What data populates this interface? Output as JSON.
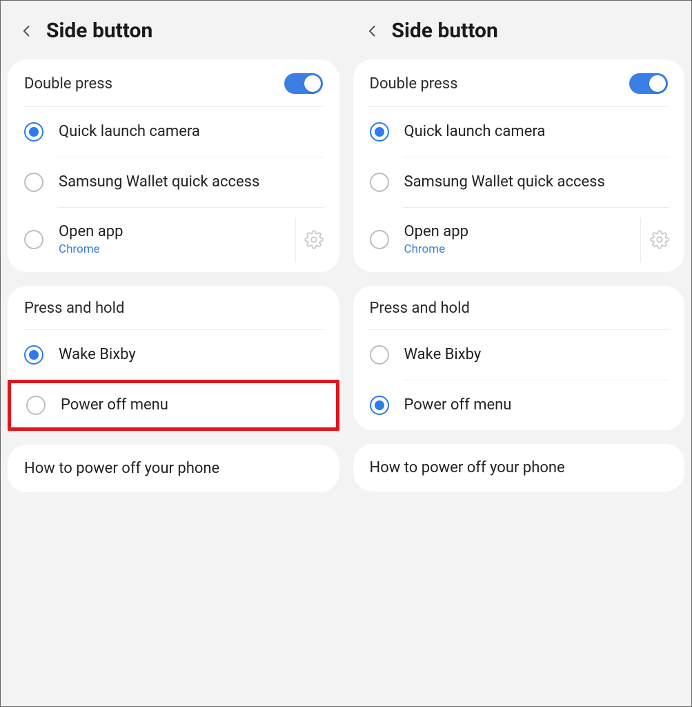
{
  "left": {
    "title": "Side button",
    "doublePress": {
      "header": "Double press",
      "toggleOn": true,
      "options": [
        {
          "label": "Quick launch camera",
          "sub": null,
          "selected": true,
          "gear": false
        },
        {
          "label": "Samsung Wallet quick access",
          "sub": null,
          "selected": false,
          "gear": false
        },
        {
          "label": "Open app",
          "sub": "Chrome",
          "selected": false,
          "gear": true
        }
      ]
    },
    "pressHold": {
      "header": "Press and hold",
      "options": [
        {
          "label": "Wake Bixby",
          "selected": true
        },
        {
          "label": "Power off menu",
          "selected": false,
          "highlighted": true
        }
      ]
    },
    "help": "How to power off your phone"
  },
  "right": {
    "title": "Side button",
    "doublePress": {
      "header": "Double press",
      "toggleOn": true,
      "options": [
        {
          "label": "Quick launch camera",
          "sub": null,
          "selected": true,
          "gear": false
        },
        {
          "label": "Samsung Wallet quick access",
          "sub": null,
          "selected": false,
          "gear": false
        },
        {
          "label": "Open app",
          "sub": "Chrome",
          "selected": false,
          "gear": true
        }
      ]
    },
    "pressHold": {
      "header": "Press and hold",
      "options": [
        {
          "label": "Wake Bixby",
          "selected": false
        },
        {
          "label": "Power off menu",
          "selected": true
        }
      ]
    },
    "help": "How to power off your phone"
  }
}
